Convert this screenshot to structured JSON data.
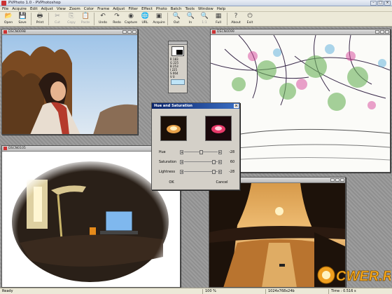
{
  "app": {
    "title": "PVPhoto 1.0 - PVPhotoshop"
  },
  "menu": [
    "File",
    "Acquire",
    "Edit",
    "Adjust",
    "View",
    "Zoom",
    "Color",
    "Frame",
    "Adjust",
    "Filter",
    "Effect",
    "Photo",
    "Batch",
    "Tools",
    "Window",
    "Help"
  ],
  "toolbar": [
    {
      "icon": "open-icon",
      "glyph": "📂",
      "label": "Open",
      "enabled": true
    },
    {
      "icon": "save-icon",
      "glyph": "💾",
      "label": "Save",
      "enabled": true
    },
    {
      "sep": true
    },
    {
      "icon": "print-icon",
      "glyph": "🖶",
      "label": "Print",
      "enabled": true
    },
    {
      "sep": true
    },
    {
      "icon": "cut-icon",
      "glyph": "✂",
      "label": "Cut",
      "enabled": false
    },
    {
      "icon": "copy-icon",
      "glyph": "⎘",
      "label": "Copy",
      "enabled": false
    },
    {
      "icon": "paste-icon",
      "glyph": "📋",
      "label": "Paste",
      "enabled": false
    },
    {
      "sep": true
    },
    {
      "icon": "undo-icon",
      "glyph": "↶",
      "label": "Undo",
      "enabled": true
    },
    {
      "icon": "redo-icon",
      "glyph": "↷",
      "label": "Redo",
      "enabled": true
    },
    {
      "icon": "capture-icon",
      "glyph": "◉",
      "label": "Capture",
      "enabled": true
    },
    {
      "icon": "url-icon",
      "glyph": "🌐",
      "label": "URL",
      "enabled": true
    },
    {
      "icon": "acquire-icon",
      "glyph": "▣",
      "label": "Acquire",
      "enabled": true
    },
    {
      "sep": true
    },
    {
      "icon": "zoom-out-icon",
      "glyph": "🔍",
      "label": "Out",
      "enabled": true
    },
    {
      "icon": "zoom-in-icon",
      "glyph": "🔍",
      "label": "In",
      "enabled": true
    },
    {
      "icon": "zoom-fit-icon",
      "glyph": "🔍",
      "label": "1:1",
      "enabled": false
    },
    {
      "icon": "full-icon",
      "glyph": "▦",
      "label": "Full",
      "enabled": true
    },
    {
      "sep": true
    },
    {
      "icon": "about-icon",
      "glyph": "?",
      "label": "About",
      "enabled": true
    },
    {
      "icon": "exit-icon",
      "glyph": "⏻",
      "label": "Exit",
      "enabled": true
    }
  ],
  "windows": {
    "portrait": {
      "title": "DSCN0098"
    },
    "sketch": {
      "title": "DSCN0099"
    },
    "desk": {
      "title": "DSCN0105"
    },
    "river": {
      "title": "DSCN0105"
    }
  },
  "palette": {
    "lines": [
      "R 183",
      "G 225",
      "B 253",
      "I 225",
      "S 064",
      "V 0"
    ]
  },
  "dialog": {
    "title": "Hue and Saturation",
    "rows": [
      {
        "label": "Hue",
        "value": "-28",
        "level": 0.5
      },
      {
        "label": "Saturation",
        "value": "60",
        "level": 0.92
      },
      {
        "label": "Lightness",
        "value": "-28",
        "level": 0.92
      }
    ],
    "ok": "OK",
    "cancel": "Cancel"
  },
  "status": {
    "ready": "Ready",
    "zoom": "100 %",
    "info": "1024x768x24b",
    "time": "Time : 0.516 s"
  },
  "watermark": "CWER.RU"
}
